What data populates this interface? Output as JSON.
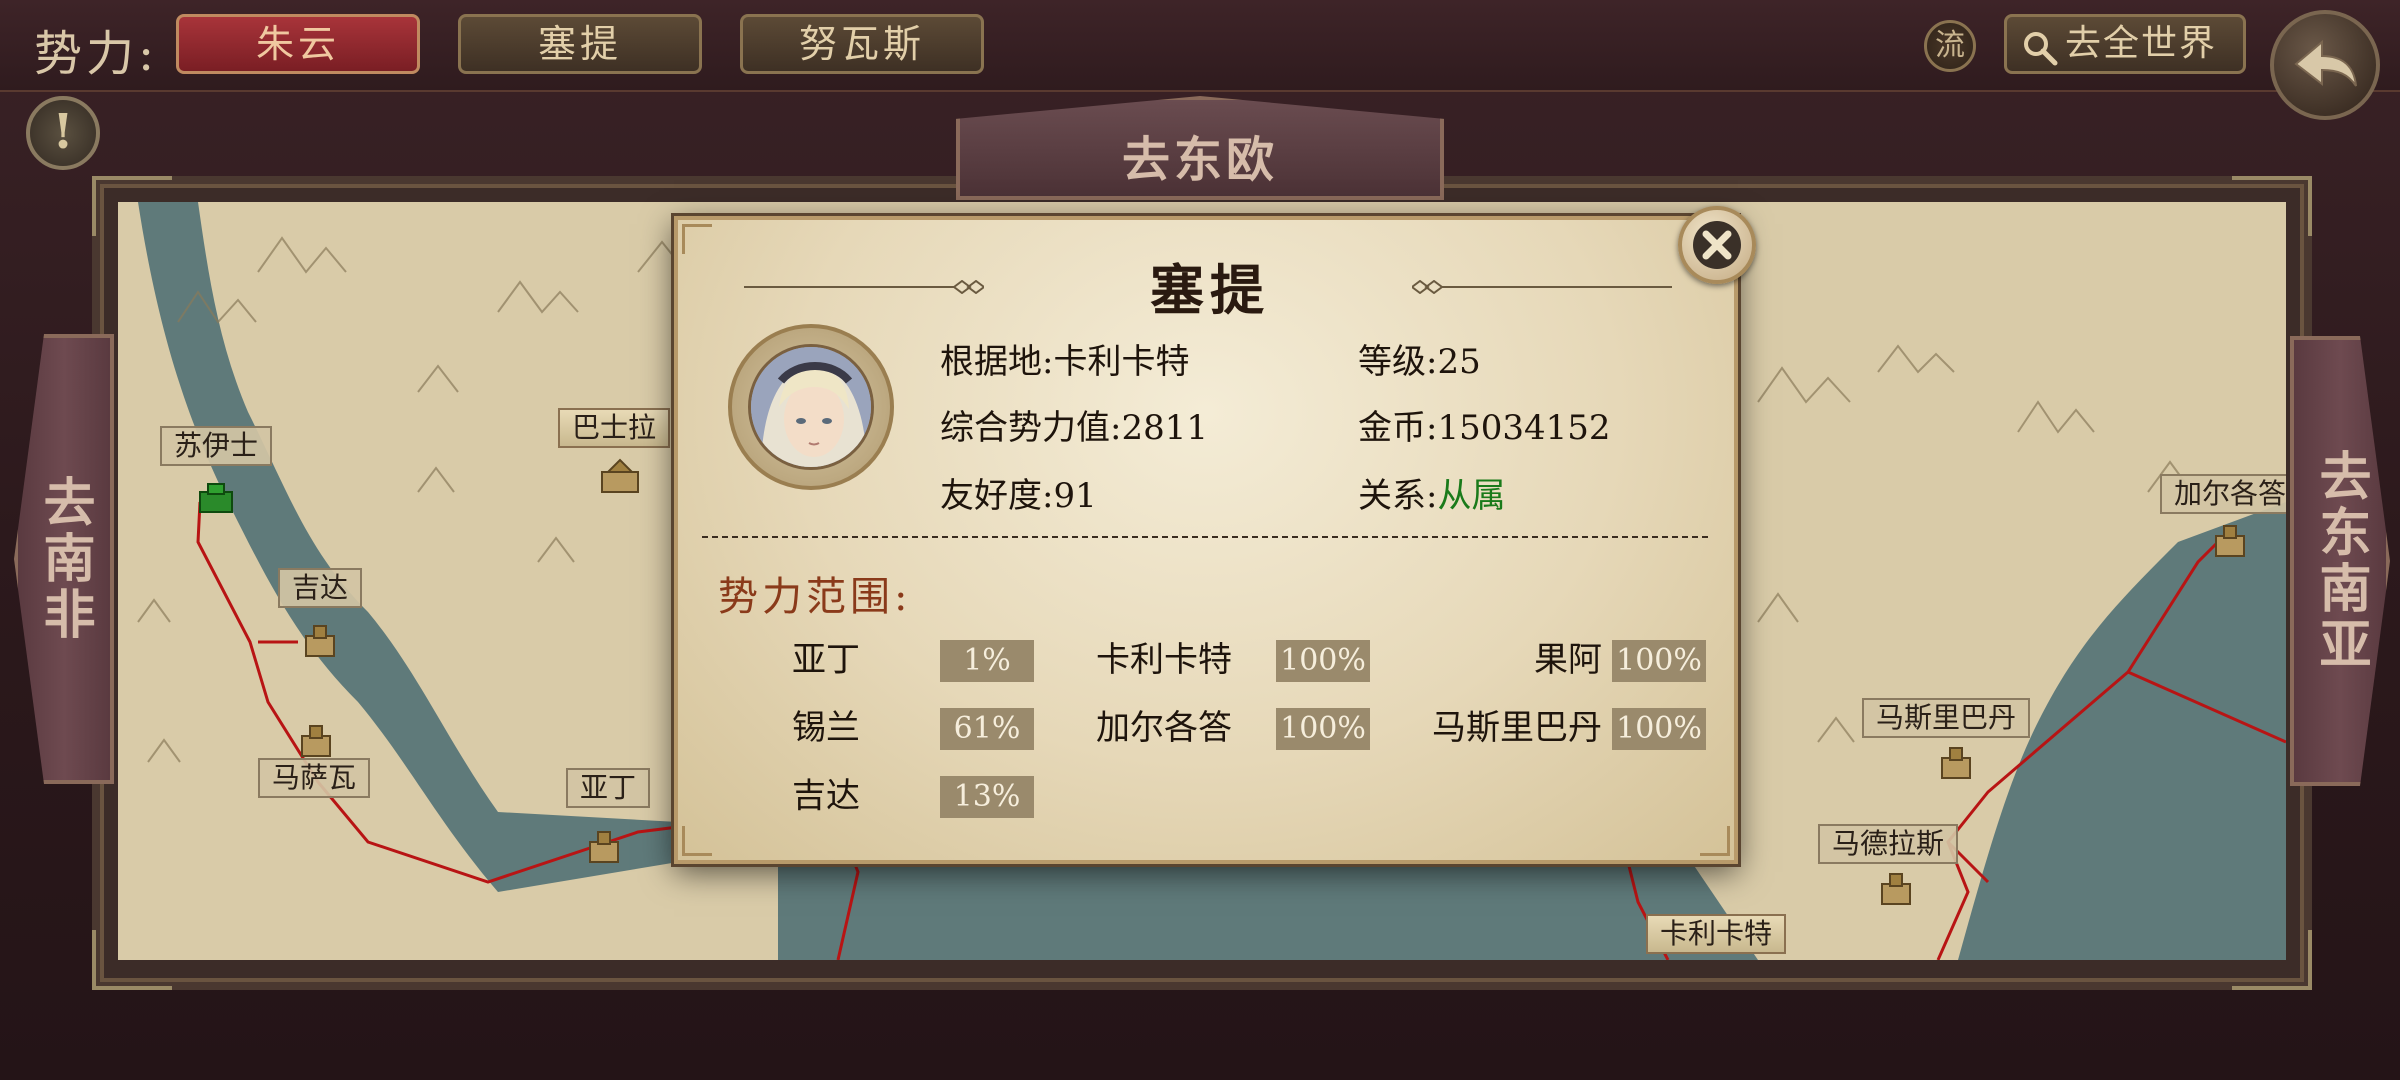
{
  "topbar": {
    "faction_label": "势力:",
    "tabs": [
      {
        "label": "朱云",
        "active": true
      },
      {
        "label": "塞提",
        "active": false
      },
      {
        "label": "努瓦斯",
        "active": false
      }
    ],
    "liu_label": "流",
    "world_button_label": "去全世界",
    "icons": [
      "search-icon",
      "back-arrow-icon",
      "exclamation-icon",
      "close-icon"
    ]
  },
  "map": {
    "go_east_europe": "去东欧",
    "go_south_africa": "去南非",
    "go_southeast_asia": "去东南亚",
    "cities": [
      {
        "name": "苏伊士",
        "marker": "green-fort"
      },
      {
        "name": "巴士拉"
      },
      {
        "name": "吉达"
      },
      {
        "name": "马萨瓦"
      },
      {
        "name": "亚丁"
      },
      {
        "name": "加尔各答"
      },
      {
        "name": "马斯里巴丹"
      },
      {
        "name": "马德拉斯"
      },
      {
        "name": "卡利卡特"
      }
    ]
  },
  "dialog": {
    "title": "塞提",
    "base_label": "根据地:",
    "base_value": "卡利卡特",
    "level_label": "等级:",
    "level_value": "25",
    "power_label": "综合势力值:",
    "power_value": "2811",
    "gold_label": "金币:",
    "gold_value": "15034152",
    "friendship_label": "友好度:",
    "friendship_value": "91",
    "relation_label": "关系:",
    "relation_value": "从属",
    "relation_color": "#1a7a1a",
    "sphere_title": "势力范围:",
    "sphere": [
      {
        "name": "亚丁",
        "pct": "1%"
      },
      {
        "name": "卡利卡特",
        "pct": "100%"
      },
      {
        "name": "果阿",
        "pct": "100%"
      },
      {
        "name": "锡兰",
        "pct": "61%"
      },
      {
        "name": "加尔各答",
        "pct": "100%"
      },
      {
        "name": "马斯里巴丹",
        "pct": "100%"
      },
      {
        "name": "吉达",
        "pct": "13%"
      }
    ]
  },
  "colors": {
    "active_tab": "#a8343a",
    "route": "#b81414",
    "sea": "#5f7a7a",
    "land": "#d9cba8"
  }
}
